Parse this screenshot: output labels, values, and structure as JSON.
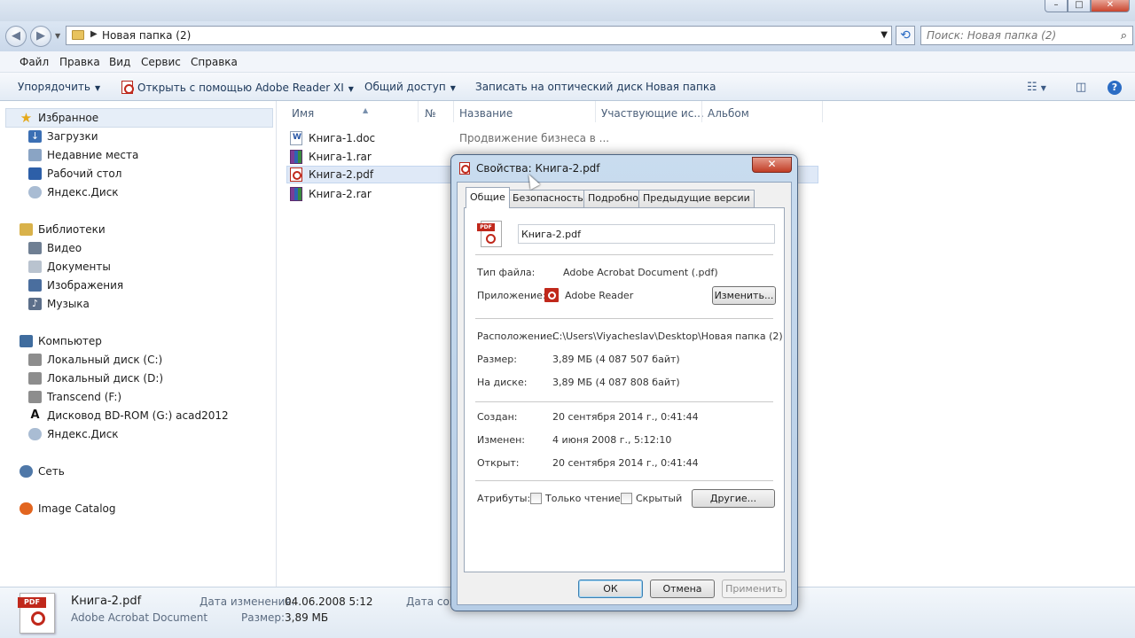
{
  "address": {
    "path": "Новая папка (2)"
  },
  "search": {
    "placeholder": "Поиск: Новая папка (2)"
  },
  "menu": [
    "Файл",
    "Правка",
    "Вид",
    "Сервис",
    "Справка"
  ],
  "toolbar": {
    "organize": "Упорядочить",
    "open_with": "Открыть с помощью Adobe Reader XI",
    "share": "Общий доступ",
    "burn": "Записать на оптический диск",
    "new_folder": "Новая папка"
  },
  "sidebar": {
    "favorites": {
      "label": "Избранное",
      "items": [
        "Загрузки",
        "Недавние места",
        "Рабочий стол",
        "Яндекс.Диск"
      ]
    },
    "libraries": {
      "label": "Библиотеки",
      "items": [
        "Видео",
        "Документы",
        "Изображения",
        "Музыка"
      ]
    },
    "computer": {
      "label": "Компьютер",
      "items": [
        "Локальный диск (C:)",
        "Локальный диск (D:)",
        "Transcend (F:)",
        "Дисковод BD-ROM (G:) acad2012",
        "Яндекс.Диск"
      ]
    },
    "network": "Сеть",
    "catalog": "Image Catalog"
  },
  "columns": [
    "Имя",
    "№",
    "Название",
    "Участвующие ис...",
    "Альбом"
  ],
  "files": [
    {
      "name": "Книга-1.doc",
      "title": "Продвижение бизнеса в ..."
    },
    {
      "name": "Книга-1.rar",
      "title": ""
    },
    {
      "name": "Книга-2.pdf",
      "title": ""
    },
    {
      "name": "Книга-2.rar",
      "title": ""
    }
  ],
  "details": {
    "name": "Книга-2.pdf",
    "type": "Adobe Acrobat Document",
    "modified_label": "Дата изменения:",
    "modified": "04.06.2008 5:12",
    "size_label": "Размер:",
    "size": "3,89 МБ",
    "created_label_partial": "Дата созд"
  },
  "dialog": {
    "title": "Свойства: Книга-2.pdf",
    "close": "✕",
    "tabs": [
      "Общие",
      "Безопасность",
      "Подробно",
      "Предыдущие версии"
    ],
    "filename": "Книга-2.pdf",
    "filetype_label": "Тип файла:",
    "filetype": "Adobe Acrobat Document (.pdf)",
    "app_label": "Приложение:",
    "app": "Adobe Reader",
    "change": "Изменить...",
    "location_label": "Расположение:",
    "location": "C:\\Users\\Viyacheslav\\Desktop\\Новая папка (2)",
    "size_label": "Размер:",
    "size": "3,89 МБ (4 087 507 байт)",
    "disk_label": "На диске:",
    "disk": "3,89 МБ (4 087 808 байт)",
    "created_label": "Создан:",
    "created": "20 сентября 2014 г., 0:41:44",
    "modified_label": "Изменен:",
    "modified": "4 июня 2008 г., 5:12:10",
    "opened_label": "Открыт:",
    "opened": "20 сентября 2014 г., 0:41:44",
    "attrs_label": "Атрибуты:",
    "readonly": "Только чтение",
    "hidden": "Скрытый",
    "other": "Другие...",
    "ok": "ОК",
    "cancel": "Отмена",
    "apply": "Применить"
  }
}
